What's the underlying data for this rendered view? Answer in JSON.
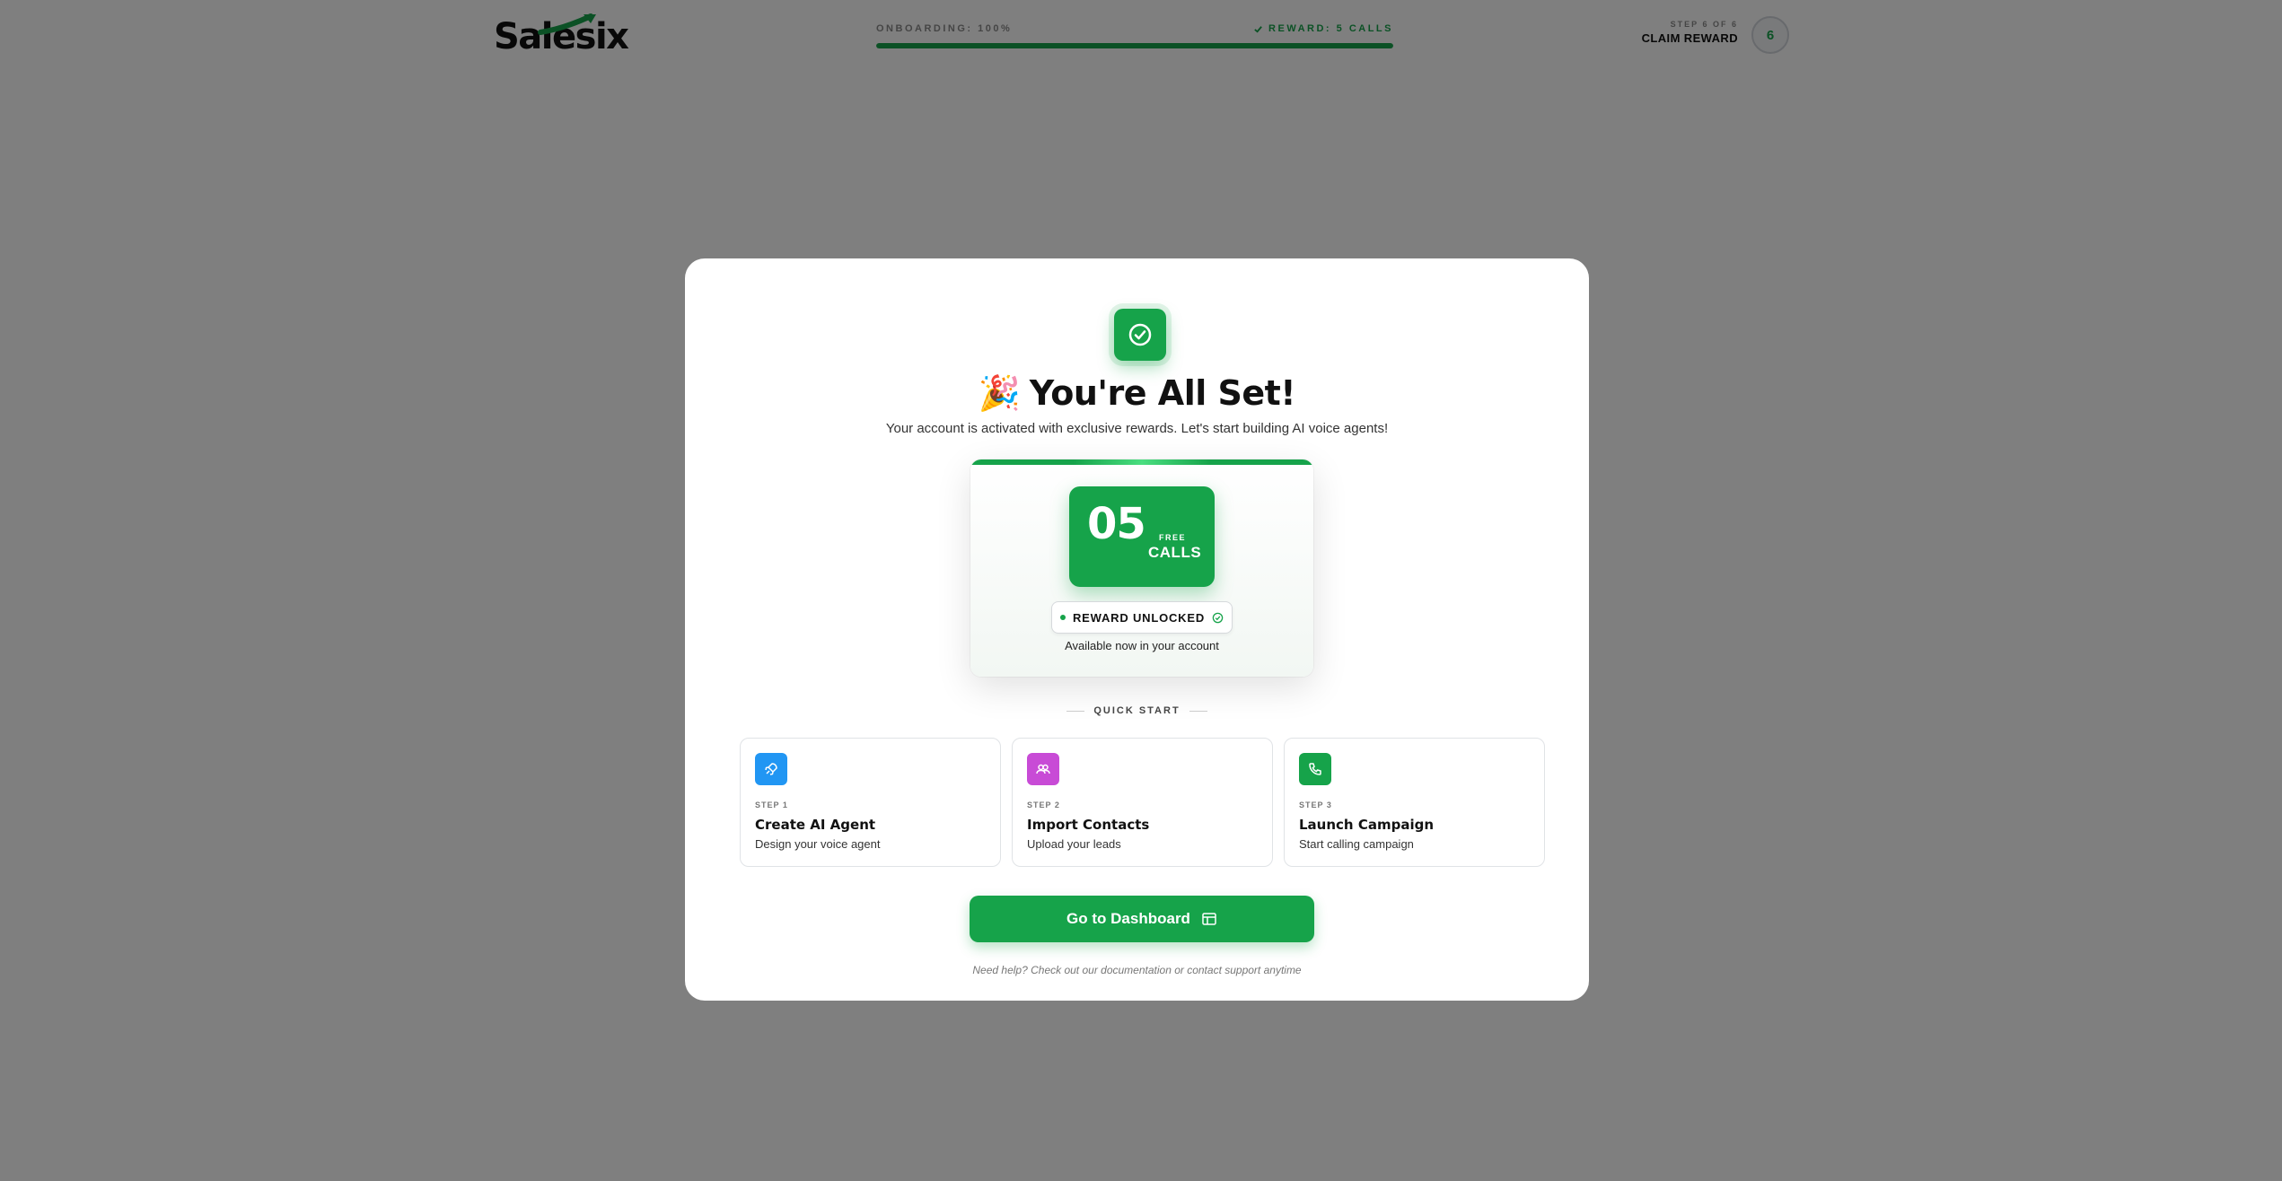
{
  "header": {
    "logo_text": "Salesix",
    "progress_label": "ONBOARDING: 100%",
    "progress_value": 1.0,
    "reward_label": "REWARD: 5 CALLS",
    "step_small": "STEP 6 OF 6",
    "step_title": "CLAIM REWARD",
    "step_number": "6"
  },
  "modal": {
    "emoji": "🎉",
    "title": "You're All Set!",
    "subtitle": "Your account is activated with exclusive rewards. Let's start building AI voice agents!",
    "reward": {
      "number": "05",
      "free_label": "FREE",
      "calls_label": "CALLS",
      "unlocked_label": "REWARD UNLOCKED",
      "available_text": "Available now in your account"
    },
    "quick_start_label": "QUICK START",
    "steps": [
      {
        "number": "STEP 1",
        "title": "Create AI Agent",
        "desc": "Design your voice agent",
        "color": "#2196f3",
        "icon": "rocket-icon"
      },
      {
        "number": "STEP 2",
        "title": "Import Contacts",
        "desc": "Upload your leads",
        "color": "#c84bd6",
        "icon": "users-icon"
      },
      {
        "number": "STEP 3",
        "title": "Launch Campaign",
        "desc": "Start calling campaign",
        "color": "#16a34a",
        "icon": "phone-icon"
      }
    ],
    "dashboard_button": "Go to Dashboard",
    "help_text": "Need help? Check out our documentation or contact support anytime"
  },
  "colors": {
    "accent": "#16a34a",
    "overlay": "rgba(0,0,0,0.5)"
  }
}
